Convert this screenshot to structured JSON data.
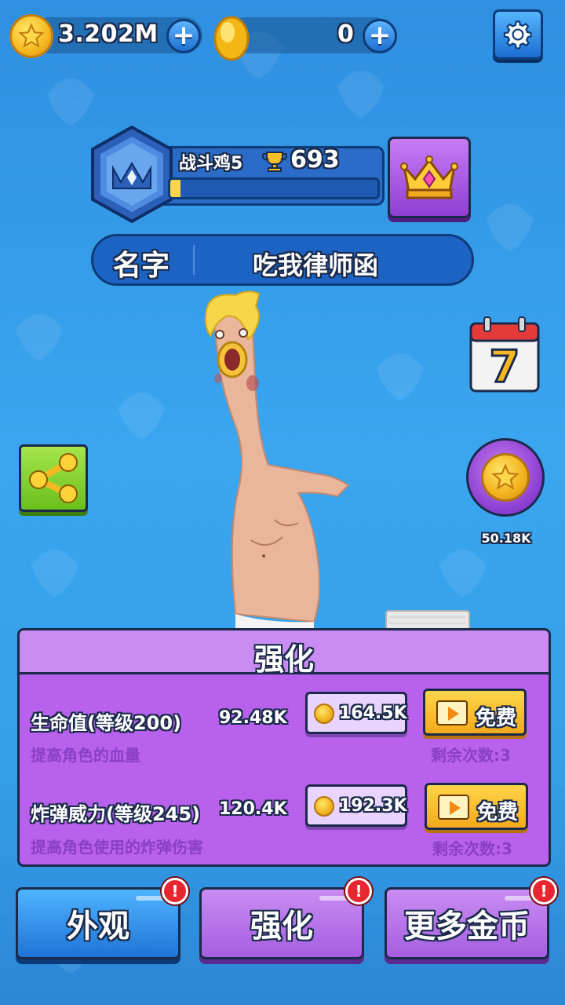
{
  "currency": {
    "coins": "3.202M",
    "gems": "0"
  },
  "profile": {
    "rank_name": "战斗鸡5",
    "trophies": "693",
    "rank_progress": 0.05,
    "name_label": "名字",
    "name_value": "吃我律师函"
  },
  "side": {
    "calendar_day": "7",
    "coin_reward": "50.18K"
  },
  "upgrade_panel": {
    "title": "强化",
    "rows": [
      {
        "title": "生命值(等级200)",
        "value": "92.48K",
        "desc": "提高角色的血量",
        "cost": "164.5K",
        "free_label": "免费",
        "remaining": "剩余次数:3"
      },
      {
        "title": "炸弹威力(等级245)",
        "value": "120.4K",
        "desc": "提高角色使用的炸弹伤害",
        "cost": "192.3K",
        "free_label": "免费",
        "remaining": "剩余次数:3"
      }
    ]
  },
  "tabs": [
    {
      "label": "外观",
      "badge": "!"
    },
    {
      "label": "强化",
      "badge": "!"
    },
    {
      "label": "更多金币",
      "badge": "!"
    }
  ],
  "colors": {
    "background": "#35a0ea",
    "panel": "#b761ec",
    "accent_yellow": "#f5b820",
    "badge_red": "#e8262f"
  },
  "icons": [
    "star-coin-icon",
    "gem-icon",
    "plus-icon",
    "gear-icon",
    "rank-shield-icon",
    "trophy-icon",
    "crown-icon",
    "calendar-icon",
    "share-icon",
    "video-icon"
  ]
}
